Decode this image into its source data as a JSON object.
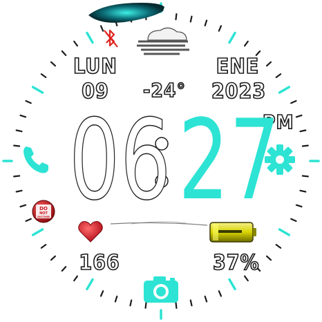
{
  "date": {
    "weekday": "LUN",
    "day": "09",
    "month": "ENE",
    "year": "2023"
  },
  "weather": {
    "temperature": "-24°",
    "icon": "fog-cloud-icon"
  },
  "time": {
    "hours": "06",
    "minutes": "27",
    "ampm": "PM",
    "separator": ":"
  },
  "stats": {
    "heart_rate": "166",
    "battery": "37%"
  },
  "status": {
    "bluetooth": "bluetooth-off-icon",
    "dnd": "do-not-disturb-icon",
    "dnd_text": "DO NOT DISTURB"
  },
  "shortcuts": {
    "left": "phone-icon",
    "right": "settings-gear-icon",
    "bottom": "camera-icon"
  },
  "colors": {
    "accent": "#2de3d4",
    "tick": "#1b1b1b",
    "heart": "#d81f2a",
    "battery": "#d7d400",
    "dnd": "#c7151b"
  }
}
